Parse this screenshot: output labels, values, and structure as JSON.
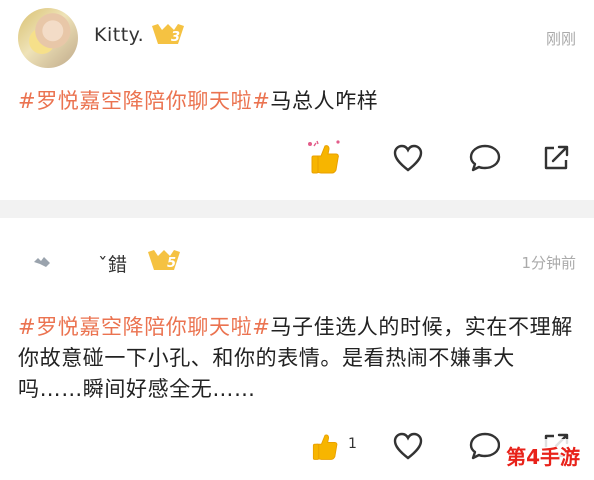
{
  "posts": [
    {
      "username": "Kitty.",
      "level": "3",
      "time": "刚刚",
      "topic": "#罗悦嘉空降陪你聊天啦#",
      "text": "马总人咋样",
      "likes": ""
    },
    {
      "username": "ˇ錯",
      "level": "5",
      "time": "1分钟前",
      "topic": "#罗悦嘉空降陪你聊天啦#",
      "text": "马子佳选人的时候，实在不理解你故意碰一下小孔、和你的表情。是看热闹不嫌事大吗……瞬间好感全无……",
      "likes": "1"
    }
  ],
  "watermark": "第4手游",
  "colors": {
    "topic": "#eb7350",
    "badge": "#f5c242",
    "like": "#f7b500"
  },
  "icons": [
    "thumbs-up-icon",
    "heart-icon",
    "comment-icon",
    "share-icon",
    "level-badge-icon"
  ]
}
